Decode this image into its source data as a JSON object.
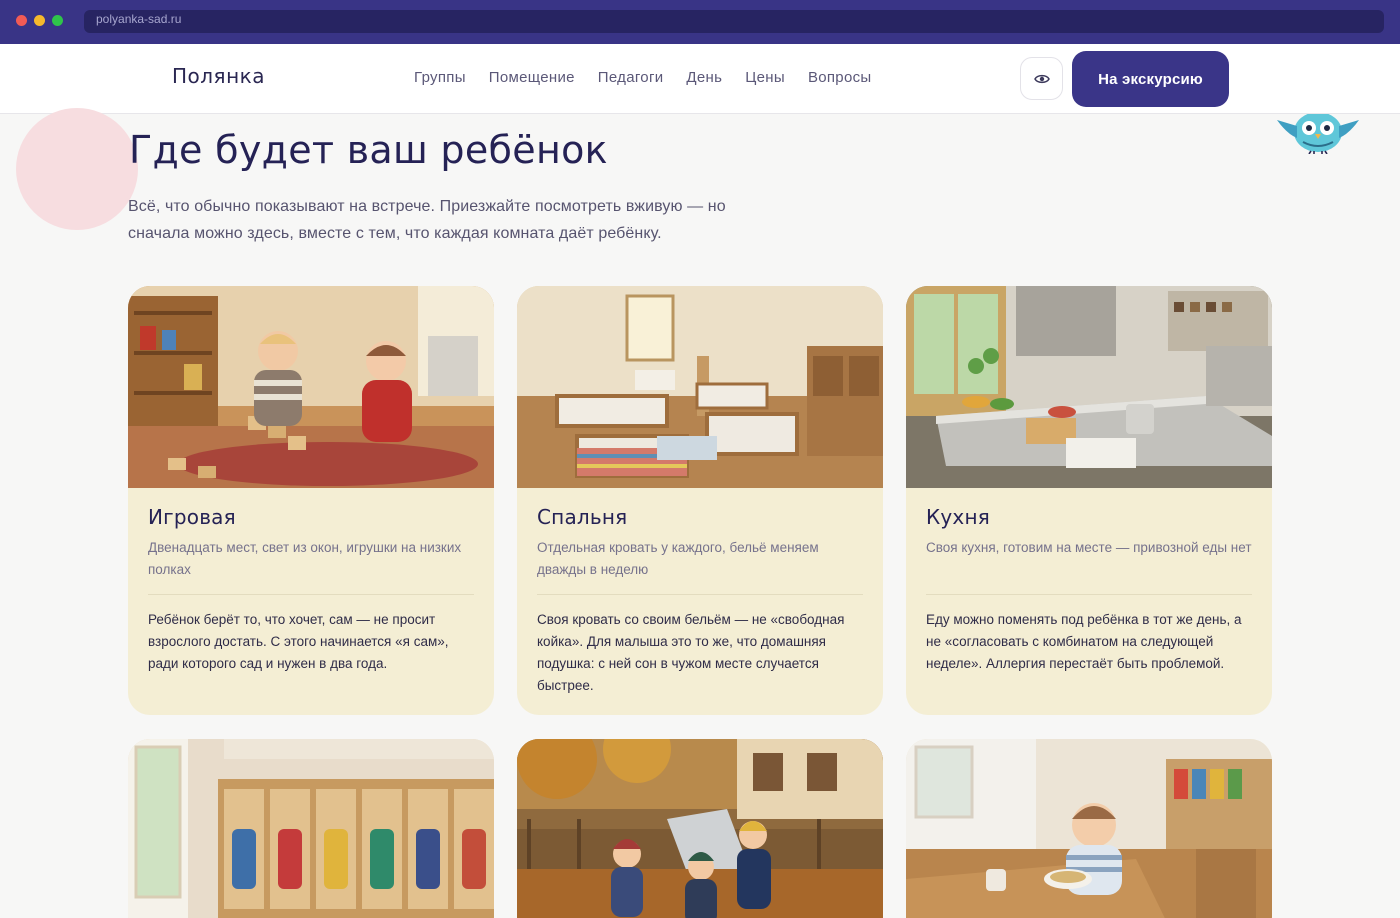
{
  "browser": {
    "url": "polyanka-sad.ru"
  },
  "header": {
    "logo": "Полянка",
    "nav": [
      "Группы",
      "Помещение",
      "Педагоги",
      "День",
      "Цены",
      "Вопросы"
    ],
    "accessibility_icon": "eye-icon",
    "cta_label": "На экскурсию"
  },
  "hero": {
    "title": "Где будет ваш ребёнок",
    "subtitle": "Всё, что обычно показывают на встрече. Приезжайте посмотреть вживую — но сначала можно здесь, вместе с тем, что каждая комната даёт ребёнку."
  },
  "rooms": [
    {
      "title": "Игровая",
      "short": "Двенадцать мест, свет из окон, игрушки на низких полках",
      "long": "Ребёнок берёт то, что хочет, сам — не просит взрослого достать. С этого начинается «я сам», ради которого сад и нужен в два года."
    },
    {
      "title": "Спальня",
      "short": "Отдельная кровать у каждого, бельё меняем дважды в неделю",
      "long": "Своя кровать со своим бельём — не «свободная койка». Для малыша это то же, что домашняя подушка: с ней сон в чужом месте случается быстрее."
    },
    {
      "title": "Кухня",
      "short": "Своя кухня, готовим на месте — привозной еды нет",
      "long": "Еду можно поменять под ребёнка в тот же день, а не «согласовать с комбинатом на следующей неделе». Аллергия перестаёт быть проблемой."
    }
  ],
  "colors": {
    "chrome": "#393486",
    "accent": "#3a3588",
    "card_bg": "#f4eed4",
    "title": "#252255",
    "deco_circle": "#f7dde0"
  }
}
